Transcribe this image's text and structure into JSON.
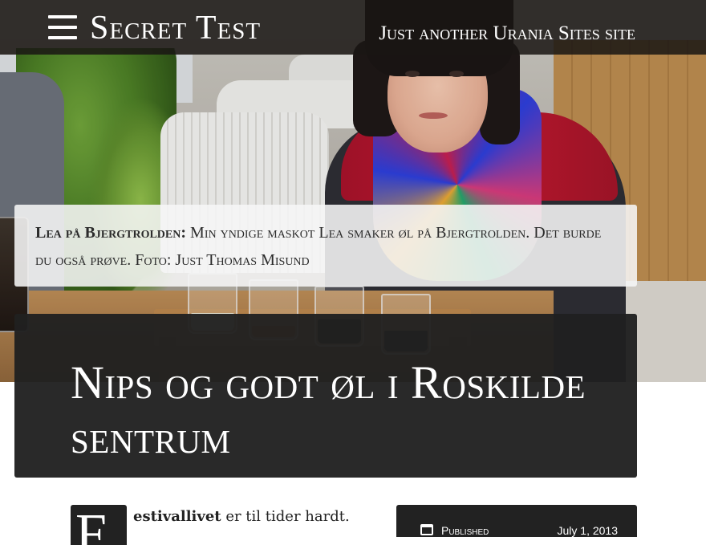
{
  "site": {
    "title": "Secret Test",
    "tagline": "Just another Urania Sites site"
  },
  "hero": {
    "caption_lead": "Lea på Bjergtrolden:",
    "caption_text": " Min yndige maskot Lea smaker øl på Bjergtrolden. Det burde du også prøve. Foto: Just Thomas Misund"
  },
  "post": {
    "title": "Nips og godt øl i Roskilde sentrum",
    "dropcap": "F",
    "intro_bold": "estivallivet",
    "intro_rest": " er til tider hardt."
  },
  "meta": {
    "label": "Published",
    "date": "July 1, 2013"
  },
  "icons": {
    "menu": "hamburger-menu-icon",
    "calendar": "calendar-icon"
  },
  "colors": {
    "topbar": "#1a1614",
    "title_block": "#202020",
    "caption_bg": "#f6f6f6"
  }
}
